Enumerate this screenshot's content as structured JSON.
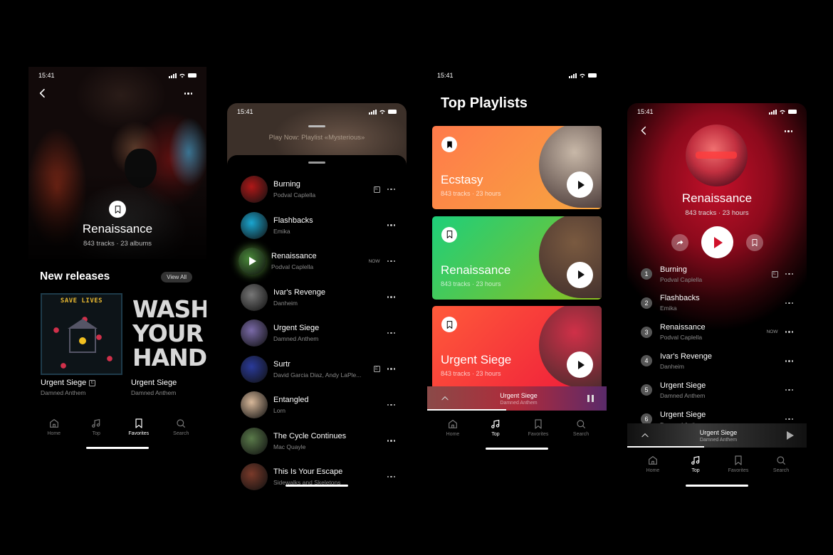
{
  "status_time": "15:41",
  "nav": {
    "home": "Home",
    "top": "Top",
    "favorites": "Favorites",
    "search": "Search"
  },
  "screen1": {
    "hero_title": "Renaissance",
    "hero_meta": "843 tracks · 23 albums",
    "section_title": "New releases",
    "view_all": "View All",
    "releases": [
      {
        "title": "Urgent Siege",
        "artist": "Damned Anthem",
        "explicit": true,
        "art_text": "SAVE LIVES"
      },
      {
        "title": "Urgent Siege",
        "artist": "Damned Anthem",
        "explicit": false,
        "art_text": [
          "WASH",
          "YOUR",
          "HANDS"
        ]
      }
    ],
    "active_tab": "favorites"
  },
  "screen2": {
    "play_now": "Play Now: Playlist «Mysterious»",
    "explicit_label": "E",
    "now_label": "NOW",
    "tracks": [
      {
        "title": "Burning",
        "artist": "Podval Caplella",
        "explicit": true,
        "now": false,
        "cover": "#b01818"
      },
      {
        "title": "Flashbacks",
        "artist": "Emika",
        "explicit": false,
        "now": false,
        "cover": "#1aa6d0"
      },
      {
        "title": "Renaissance",
        "artist": "Podval Caplella",
        "explicit": false,
        "now": true,
        "cover": "#4a8a3a"
      },
      {
        "title": "Ivar's Revenge",
        "artist": "Danheim",
        "explicit": false,
        "now": false,
        "cover": "#777777"
      },
      {
        "title": "Urgent Siege",
        "artist": "Damned Anthem",
        "explicit": false,
        "now": false,
        "cover": "#7a6aa8"
      },
      {
        "title": "Surtr",
        "artist": "David Garcia Diaz, Andy LaPle...",
        "explicit": true,
        "now": false,
        "cover": "#2a3a9a"
      },
      {
        "title": "Entangled",
        "artist": "Lorn",
        "explicit": false,
        "now": false,
        "cover": "#d8b89a"
      },
      {
        "title": "The Cycle Continues",
        "artist": "Mac Quayle",
        "explicit": false,
        "now": false,
        "cover": "#5a7a4a"
      },
      {
        "title": "This Is Your Escape",
        "artist": "Sidewalks and Skeletons",
        "explicit": false,
        "now": false,
        "cover": "#7a3a2a"
      }
    ]
  },
  "screen3": {
    "title": "Top Playlists",
    "playlists": [
      {
        "name": "Ecstasy",
        "meta": "843 tracks · 23 hours",
        "gradient_from": "#ff7a4a",
        "gradient_to": "#f7a640",
        "image": "#c8b8a8"
      },
      {
        "name": "Renaissance",
        "meta": "843 tracks · 23 hours",
        "gradient_from": "#1ecf7a",
        "gradient_to": "#8cc020",
        "image": "#7a5a40"
      },
      {
        "name": "Urgent Siege",
        "meta": "843 tracks · 23 hours",
        "gradient_from": "#ff5a3a",
        "gradient_to": "#ee1a3a",
        "image": "#d03048"
      }
    ],
    "mini_player": {
      "title": "Urgent Siege",
      "artist": "Damned Anthem",
      "progress": 0.44
    },
    "active_tab": "top"
  },
  "screen4": {
    "title": "Renaissance",
    "meta": "843 tracks · 23 hours",
    "explicit_label": "E",
    "now_label": "NOW",
    "tracks": [
      {
        "n": "1",
        "title": "Burning",
        "artist": "Podval Caplella",
        "explicit": true,
        "now": false
      },
      {
        "n": "2",
        "title": "Flashbacks",
        "artist": "Emika",
        "explicit": false,
        "now": false
      },
      {
        "n": "3",
        "title": "Renaissance",
        "artist": "Podval Caplella",
        "explicit": false,
        "now": true
      },
      {
        "n": "4",
        "title": "Ivar's Revenge",
        "artist": "Danheim",
        "explicit": false,
        "now": false
      },
      {
        "n": "5",
        "title": "Urgent Siege",
        "artist": "Damned Anthem",
        "explicit": false,
        "now": false
      },
      {
        "n": "6",
        "title": "Urgent Siege",
        "artist": "Damned Anthem",
        "explicit": false,
        "now": false
      }
    ],
    "mini_player": {
      "title": "Urgent Siege",
      "artist": "Damned Anthem",
      "progress": 0.43
    },
    "active_tab": "top",
    "accent": "#d0102a"
  }
}
